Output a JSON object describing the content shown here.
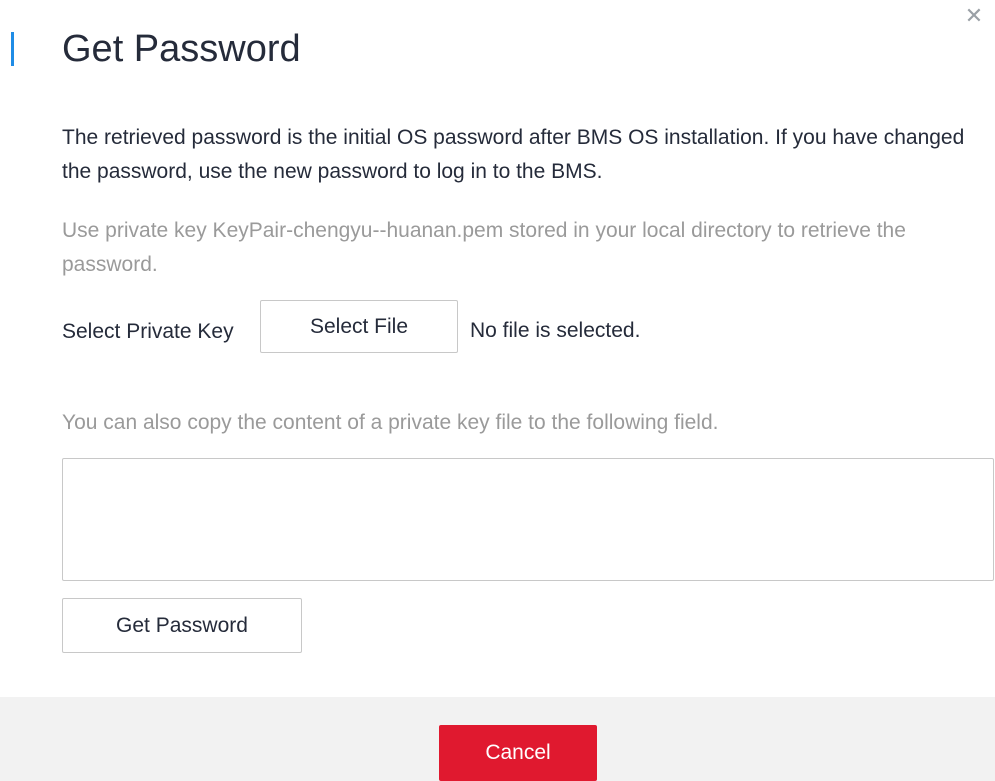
{
  "dialog": {
    "title": "Get Password",
    "close_icon": "close-icon",
    "intro": "The retrieved password is the initial OS password after BMS OS installation. If you have changed the password, use the new password to log in to the BMS.",
    "private_key_hint": "Use private key KeyPair-chengyu--huanan.pem stored in your local directory to retrieve the password.",
    "select_private_key_label": "Select Private Key",
    "select_file_button": "Select File",
    "file_status": "No file is selected.",
    "copy_hint": "You can also copy the content of a private key file to the following field.",
    "private_key_value": "",
    "get_password_button": "Get Password",
    "cancel_button": "Cancel"
  },
  "colors": {
    "accent": "#1f8ce6",
    "primary_button": "#e0192f",
    "footer_bg": "#f2f2f2",
    "hint_text": "#9a9a9a"
  }
}
